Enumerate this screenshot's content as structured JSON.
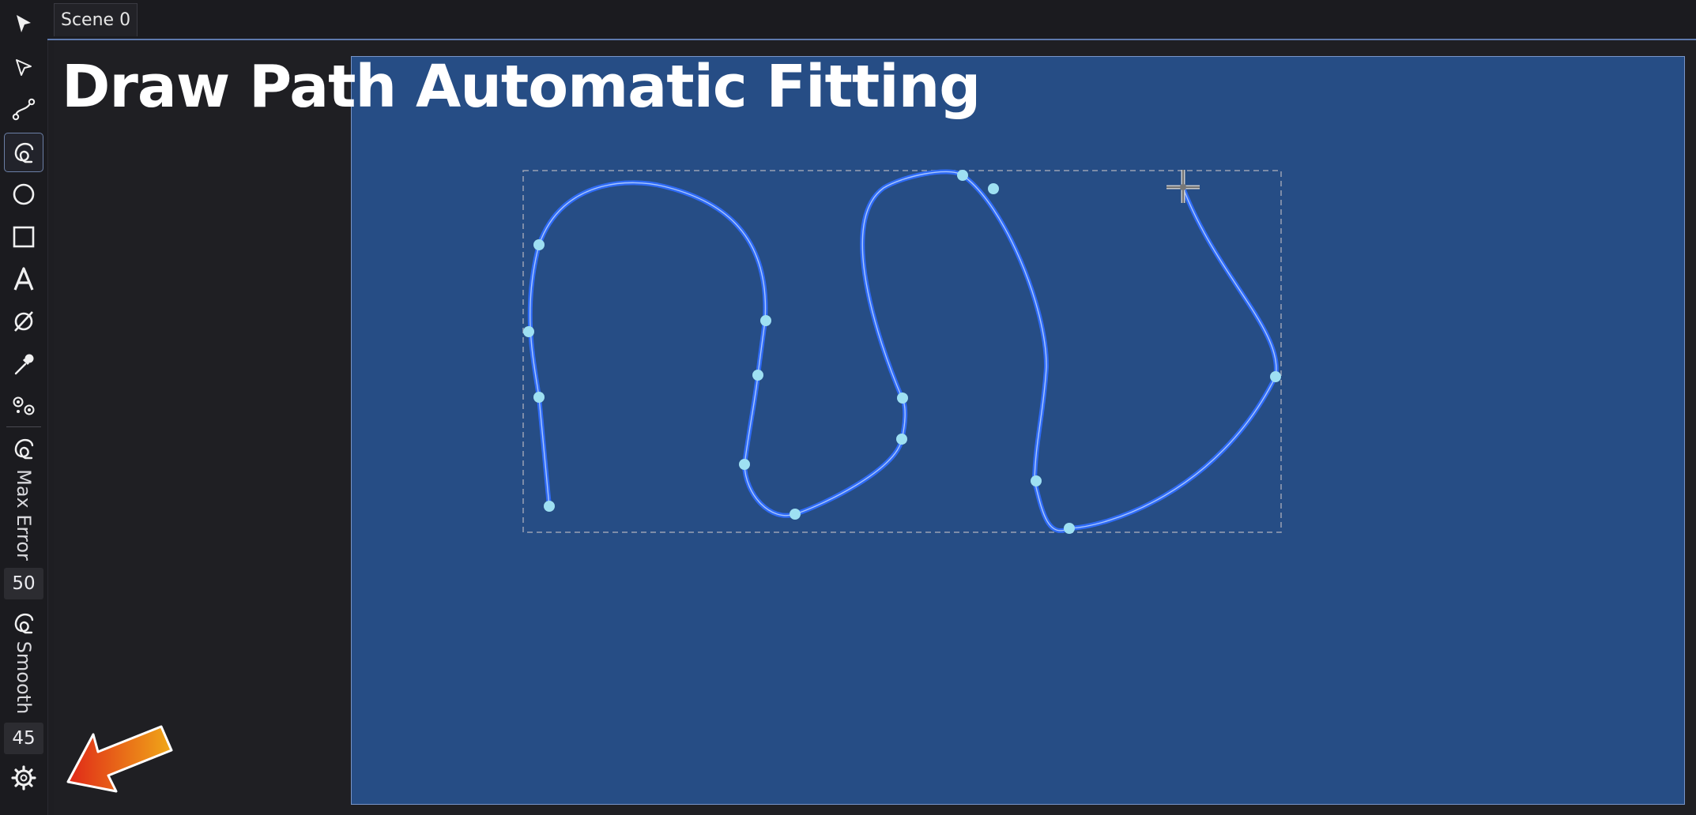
{
  "tabs": [
    {
      "label": "Scene 0"
    }
  ],
  "toolbar": {
    "tools": [
      {
        "id": "select",
        "icon": "arrow-pointer-icon"
      },
      {
        "id": "direct-select",
        "icon": "arrow-outline-icon"
      },
      {
        "id": "path",
        "icon": "bezier-path-icon"
      },
      {
        "id": "draw-path",
        "icon": "freehand-curl-icon",
        "active": true
      },
      {
        "id": "ellipse",
        "icon": "circle-icon"
      },
      {
        "id": "rectangle",
        "icon": "square-icon"
      },
      {
        "id": "text",
        "icon": "letter-a-icon"
      },
      {
        "id": "empty",
        "icon": "empty-set-icon"
      },
      {
        "id": "eyedropper",
        "icon": "eyedropper-icon"
      },
      {
        "id": "nodes",
        "icon": "nodes-icon"
      }
    ],
    "options": {
      "max_error": {
        "label": "Max Error",
        "value": "50",
        "icon": "freehand-curl-icon"
      },
      "smooth": {
        "label": "Smooth",
        "value": "45",
        "icon": "freehand-curl-icon"
      }
    },
    "settings_icon": "gear-icon"
  },
  "title": "Draw Path Automatic Fitting",
  "colors": {
    "canvas_bg": "#264d85",
    "path_stroke": "#2f6bf5",
    "node_fill": "#9ee0f2",
    "arrow_start": "#f0a818",
    "arrow_end": "#e02818"
  }
}
